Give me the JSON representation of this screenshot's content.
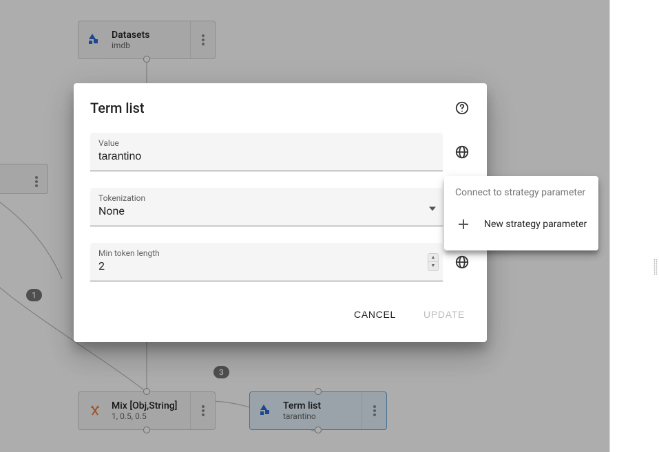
{
  "nodes": {
    "datasets": {
      "title": "Datasets",
      "subtitle": "imdb"
    },
    "mix": {
      "title": "Mix [Obj,String]",
      "subtitle": "1, 0.5, 0.5"
    },
    "termlist": {
      "title": "Term list",
      "subtitle": "tarantino"
    }
  },
  "badges": {
    "one": "1",
    "three": "3"
  },
  "dialog": {
    "title": "Term list",
    "value_label": "Value",
    "value": "tarantino",
    "tokenization_label": "Tokenization",
    "tokenization": "None",
    "minlen_label": "Min token length",
    "minlen": "2",
    "cancel": "CANCEL",
    "update": "UPDATE"
  },
  "popover": {
    "title": "Connect to strategy parameter",
    "new": "New strategy parameter"
  }
}
